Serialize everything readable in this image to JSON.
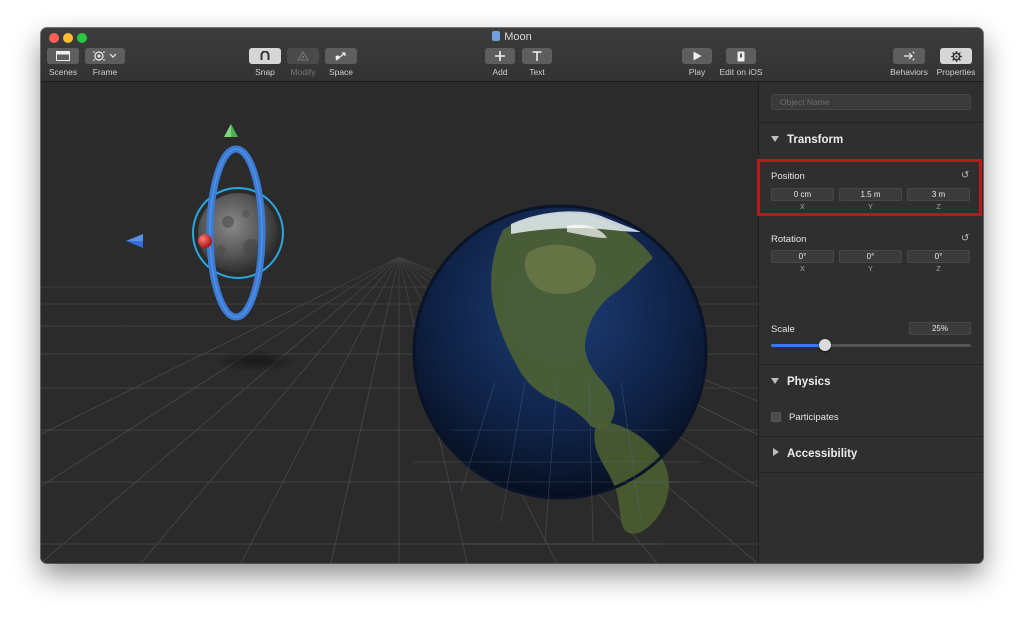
{
  "window": {
    "title": "Moon"
  },
  "toolbar": {
    "scenes_label": "Scenes",
    "frame_label": "Frame",
    "snap_label": "Snap",
    "modify_label": "Modify",
    "space_label": "Space",
    "add_label": "Add",
    "text_label": "Text",
    "play_label": "Play",
    "edit_ios_label": "Edit on iOS",
    "behaviors_label": "Behaviors",
    "properties_label": "Properties"
  },
  "inspector": {
    "object_name_placeholder": "Object Name",
    "transform": {
      "title": "Transform",
      "position": {
        "label": "Position",
        "x": "0 cm",
        "y": "1.5 m",
        "z": "3 m",
        "x_label": "X",
        "y_label": "Y",
        "z_label": "Z"
      },
      "rotation": {
        "label": "Rotation",
        "x": "0°",
        "y": "0°",
        "z": "0°",
        "x_label": "X",
        "y_label": "Y",
        "z_label": "Z"
      },
      "scale": {
        "label": "Scale",
        "value": "25%",
        "slider_fraction": 0.27
      }
    },
    "physics": {
      "title": "Physics",
      "participates_label": "Participates",
      "participates_checked": false
    },
    "accessibility": {
      "title": "Accessibility"
    }
  },
  "colors": {
    "accent": "#2f7cf6",
    "highlight_box": "#b8191b",
    "gizmo_ring": "#3a7bd5",
    "gizmo_sphere_ring": "#2aa7e0",
    "axis_x": "#d92b2b",
    "axis_y": "#4caf50",
    "axis_z": "#2f6fd6"
  }
}
